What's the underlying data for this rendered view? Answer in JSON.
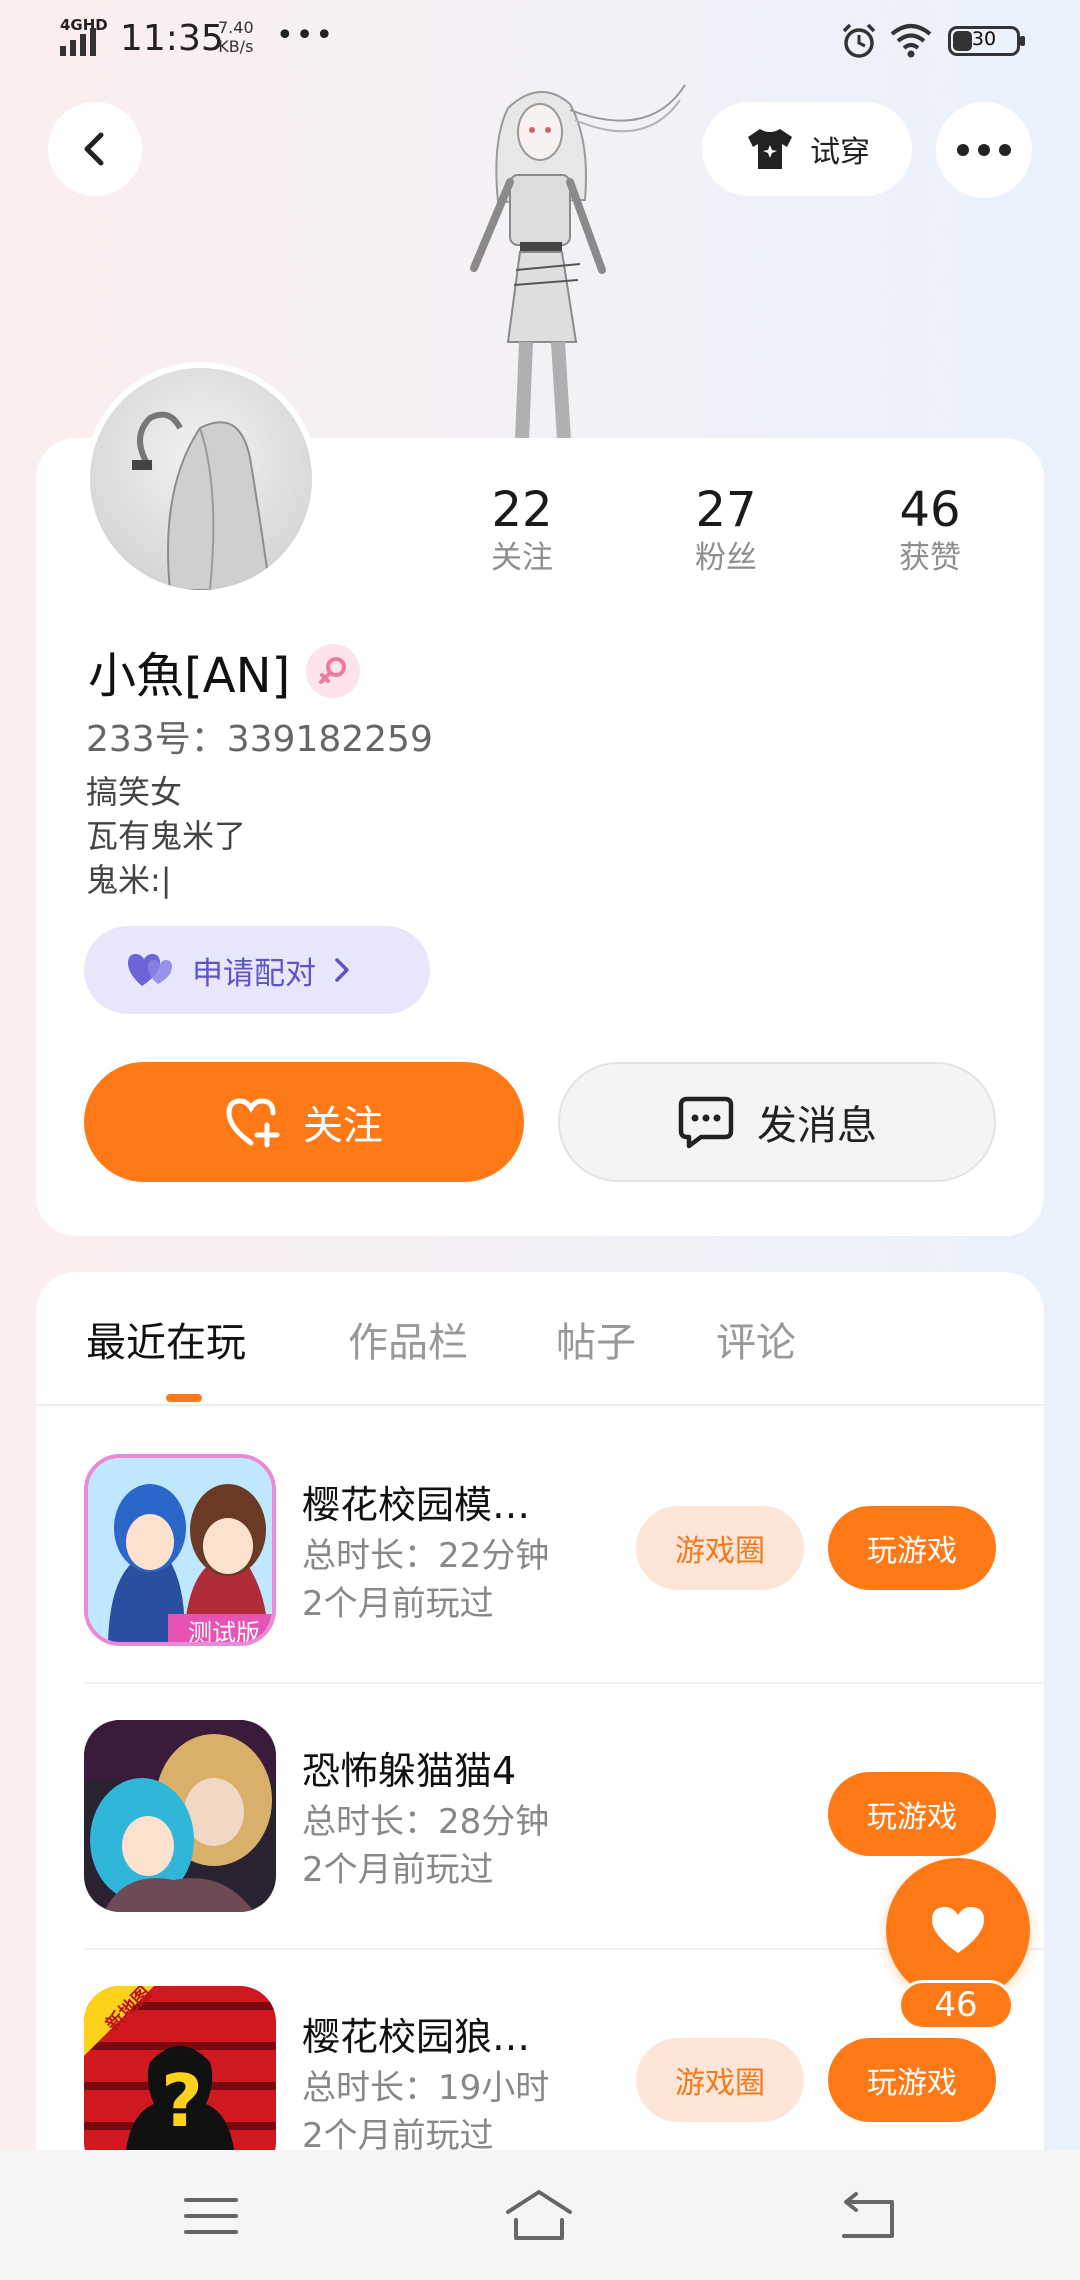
{
  "status_bar": {
    "network": "4GHD",
    "time": "11:35",
    "speed_value": "7.40",
    "speed_unit": "KB/s",
    "battery": "30",
    "battery_level": 0.3
  },
  "header": {
    "tryon_label": "试穿"
  },
  "profile": {
    "stats": [
      {
        "value": "22",
        "label": "关注"
      },
      {
        "value": "27",
        "label": "粉丝"
      },
      {
        "value": "46",
        "label": "获赞"
      }
    ],
    "username": "小魚[AN]",
    "id_line": "233号：339182259",
    "bio": [
      "搞笑女",
      "瓦有鬼米了",
      "鬼米:|"
    ],
    "pair_label": "申请配对",
    "follow_label": "关注",
    "message_label": "发消息"
  },
  "tabs": [
    {
      "label": "最近在玩",
      "active": true
    },
    {
      "label": "作品栏",
      "active": false
    },
    {
      "label": "帖子",
      "active": false
    },
    {
      "label": "评论",
      "active": false
    }
  ],
  "games": [
    {
      "title": "樱花校园模…",
      "duration": "总时长：22分钟",
      "last_played": "2个月前玩过",
      "circle_label": "游戏圈",
      "play_label": "玩游戏",
      "badge": "测试版"
    },
    {
      "title": "恐怖躲猫猫4",
      "duration": "总时长：28分钟",
      "last_played": "2个月前玩过",
      "play_label": "玩游戏"
    },
    {
      "title": "樱花校园狼…",
      "duration": "总时长：19小时",
      "last_played": "2个月前玩过",
      "circle_label": "游戏圈",
      "play_label": "玩游戏",
      "badge": "新地图"
    }
  ],
  "like_fab": {
    "count": "46"
  },
  "colors": {
    "accent": "#ff7a17",
    "accent_light": "#fde6d8",
    "pair_bg": "#e7e6fb",
    "pair_text": "#5b55c9",
    "gender": "#f07a9a"
  }
}
